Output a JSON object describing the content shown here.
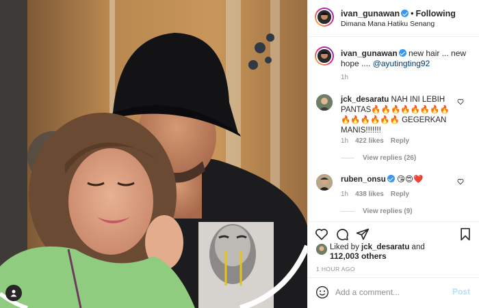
{
  "post": {
    "author": "ivan_gunawan",
    "follow_label": "Following",
    "separator": "•",
    "location": "Dimana Mana Hatiku Senang",
    "caption_text": " new hair ... new hope .... ",
    "caption_mention": "@ayutingting92",
    "caption_time": "1h"
  },
  "comments": [
    {
      "user": "jck_desaratu",
      "text": "NAH INI LEBIH PANTAS🔥🔥🔥🔥🔥🔥🔥🔥🔥🔥🔥🔥🔥🔥 GEGERKAN MANIS!!!!!!!",
      "time": "1h",
      "likes": "422 likes",
      "reply": "Reply",
      "view_replies": "View replies (26)"
    },
    {
      "user": "ruben_onsu",
      "text": "😘😍❤️",
      "time": "1h",
      "likes": "438 likes",
      "reply": "Reply",
      "view_replies": "View replies (9)"
    }
  ],
  "likes": {
    "prefix": "Liked by ",
    "user": "jck_desaratu",
    "mid": " and",
    "others": "112,003 others"
  },
  "time_ago": "1 HOUR AGO",
  "comment_box": {
    "placeholder": "Add a comment...",
    "post_label": "Post"
  },
  "colors": {
    "verified": "#3897f0",
    "post_button_disabled": "#b2dffc",
    "mention": "#00376b"
  }
}
